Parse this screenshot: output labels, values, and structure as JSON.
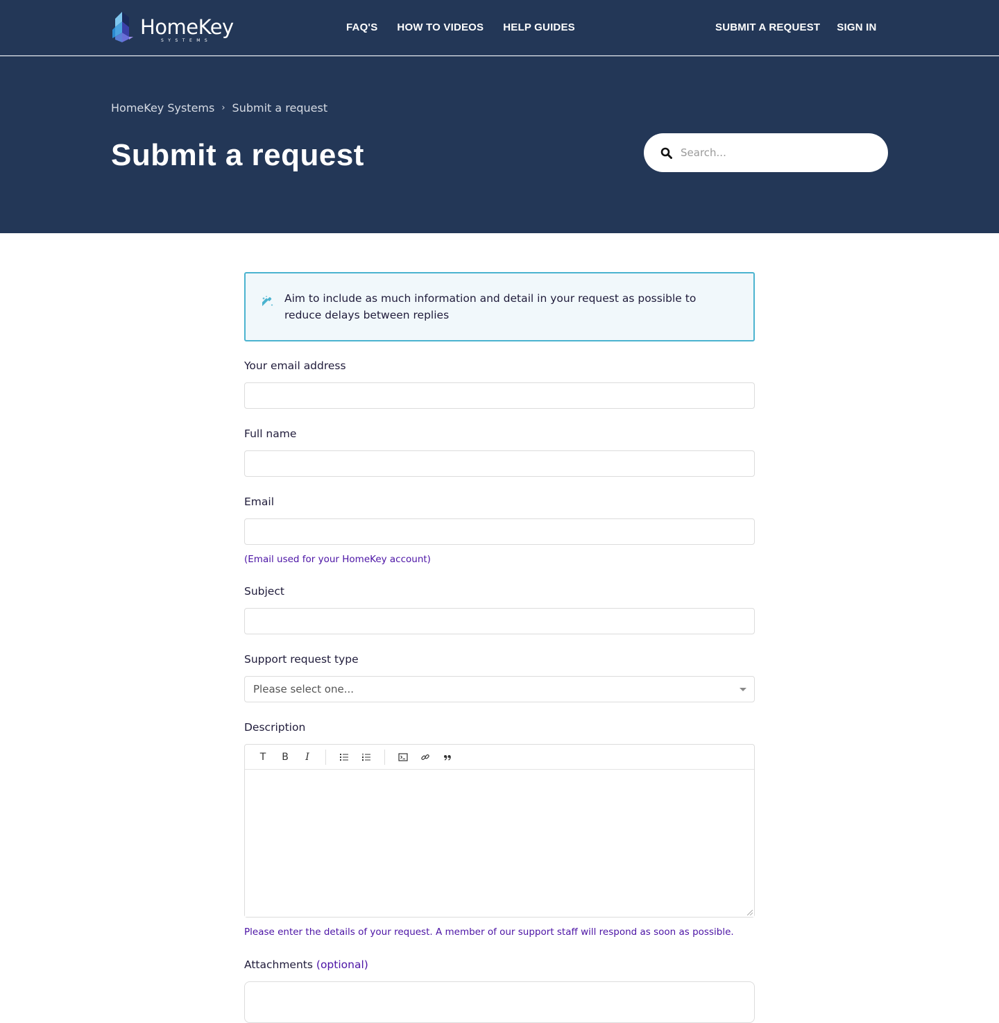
{
  "brand": {
    "name": "HomeKey",
    "sub": "SYSTEMS"
  },
  "nav": {
    "main": [
      "FAQ'S",
      "HOW TO VIDEOS",
      "HELP GUIDES"
    ],
    "right": [
      "SUBMIT A REQUEST",
      "SIGN IN"
    ]
  },
  "breadcrumb": {
    "items": [
      "HomeKey Systems",
      "Submit a request"
    ],
    "separator": "›"
  },
  "page_title": "Submit a request",
  "search": {
    "placeholder": "Search...",
    "value": ""
  },
  "notice": {
    "text": "Aim to include as much information and detail in your request as possible to reduce delays between replies",
    "icon": "magic-wand-icon"
  },
  "form": {
    "your_email": {
      "label": "Your email address",
      "value": ""
    },
    "full_name": {
      "label": "Full name",
      "value": ""
    },
    "email": {
      "label": "Email",
      "value": "",
      "hint": "(Email used for your HomeKey account)"
    },
    "subject": {
      "label": "Subject",
      "value": ""
    },
    "request_type": {
      "label": "Support request type",
      "selected": "Please select one..."
    },
    "description": {
      "label": "Description",
      "value": "",
      "hint": "Please enter the details of your request. A member of our support staff will respond as soon as possible.",
      "toolbar": [
        "T",
        "B",
        "I"
      ]
    },
    "attachments": {
      "label": "Attachments",
      "optional": "(optional)"
    }
  },
  "colors": {
    "header_bg": "#233757",
    "accent": "#4ab3cf",
    "hint": "#4b13a5"
  }
}
